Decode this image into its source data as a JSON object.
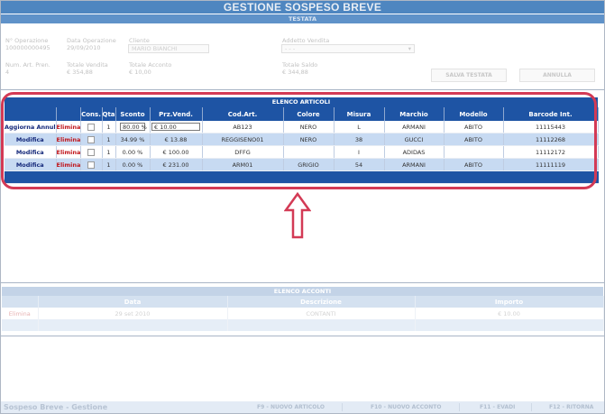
{
  "header": {
    "title": "GESTIONE SOSPESO BREVE",
    "section": "TESTATA"
  },
  "testata": {
    "operazione_label": "N° Operazione",
    "operazione_value": "100000000495",
    "data_label": "Data Operazione",
    "data_value": "29/09/2010",
    "cliente_label": "Cliente",
    "cliente_value": "MARIO BIANCHI",
    "addetto_label": "Addetto Vendita",
    "addetto_value": "- - -",
    "num_art_label": "Num. Art. Pren.",
    "num_art_value": "4",
    "totale_vendita_label": "Totale Vendita",
    "totale_vendita_value": "€ 354,88",
    "totale_acconto_label": "Totale Acconto",
    "totale_acconto_value": "€ 10,00",
    "totale_saldo_label": "Totale Saldo",
    "totale_saldo_value": "€ 344,88",
    "salva_label": "SALVA TESTATA",
    "annulla_label": "ANNULLA"
  },
  "articoli": {
    "section": "ELENCO ARTICOLI",
    "columns": [
      "",
      "",
      "Cons.",
      "Qta",
      "Sconto",
      "Prz.Vend.",
      "Cod.Art.",
      "Colore",
      "Misura",
      "Marchio",
      "Modello",
      "Barcode Int."
    ],
    "rows": [
      {
        "action": "Aggiorna Annulla",
        "elimina": "Elimina",
        "qta": "1",
        "sconto": "80.00 %",
        "prezzo": "€ 10.00",
        "cod": "AB123",
        "colore": "NERO",
        "misura": "L",
        "marchio": "ARMANI",
        "modello": "ABITO",
        "barcode": "11115443"
      },
      {
        "action": "Modifica",
        "elimina": "Elimina",
        "qta": "1",
        "sconto": "34.99 %",
        "prezzo": "€ 13.88",
        "cod": "REGGISENO01",
        "colore": "NERO",
        "misura": "38",
        "marchio": "GUCCI",
        "modello": "ABITO",
        "barcode": "11112268"
      },
      {
        "action": "Modifica",
        "elimina": "Elimina",
        "qta": "1",
        "sconto": "0.00 %",
        "prezzo": "€ 100.00",
        "cod": "DFFG",
        "colore": "",
        "misura": "I",
        "marchio": "ADIDAS",
        "modello": "",
        "barcode": "11112172"
      },
      {
        "action": "Modifica",
        "elimina": "Elimina",
        "qta": "1",
        "sconto": "0.00 %",
        "prezzo": "€ 231.00",
        "cod": "ARM01",
        "colore": "GRIGIO",
        "misura": "54",
        "marchio": "ARMANI",
        "modello": "ABITO",
        "barcode": "11111119"
      }
    ]
  },
  "acconti": {
    "section": "ELENCO ACCONTI",
    "columns": [
      "",
      "Data",
      "Descrizione",
      "Importo"
    ],
    "rows": [
      {
        "elimina": "Elimina",
        "data": "29 set 2010",
        "descrizione": "CONTANTI",
        "importo": "€ 10.00"
      }
    ]
  },
  "footer": {
    "title": "Sospeso Breve - Gestione",
    "f9": "F9 - NUOVO ARTICOLO",
    "f10": "F10 - NUOVO ACCONTO",
    "f11": "F11 - EVADI",
    "f12": "F12 - RITORNA"
  },
  "colors": {
    "grid_header": "#1e54a4",
    "alt_row": "#c7daf2",
    "highlight": "#d33a55",
    "elimina": "#c0171d"
  },
  "icons": [
    "checkbox-icon",
    "dropdown-arrow-icon",
    "up-arrow-icon"
  ]
}
